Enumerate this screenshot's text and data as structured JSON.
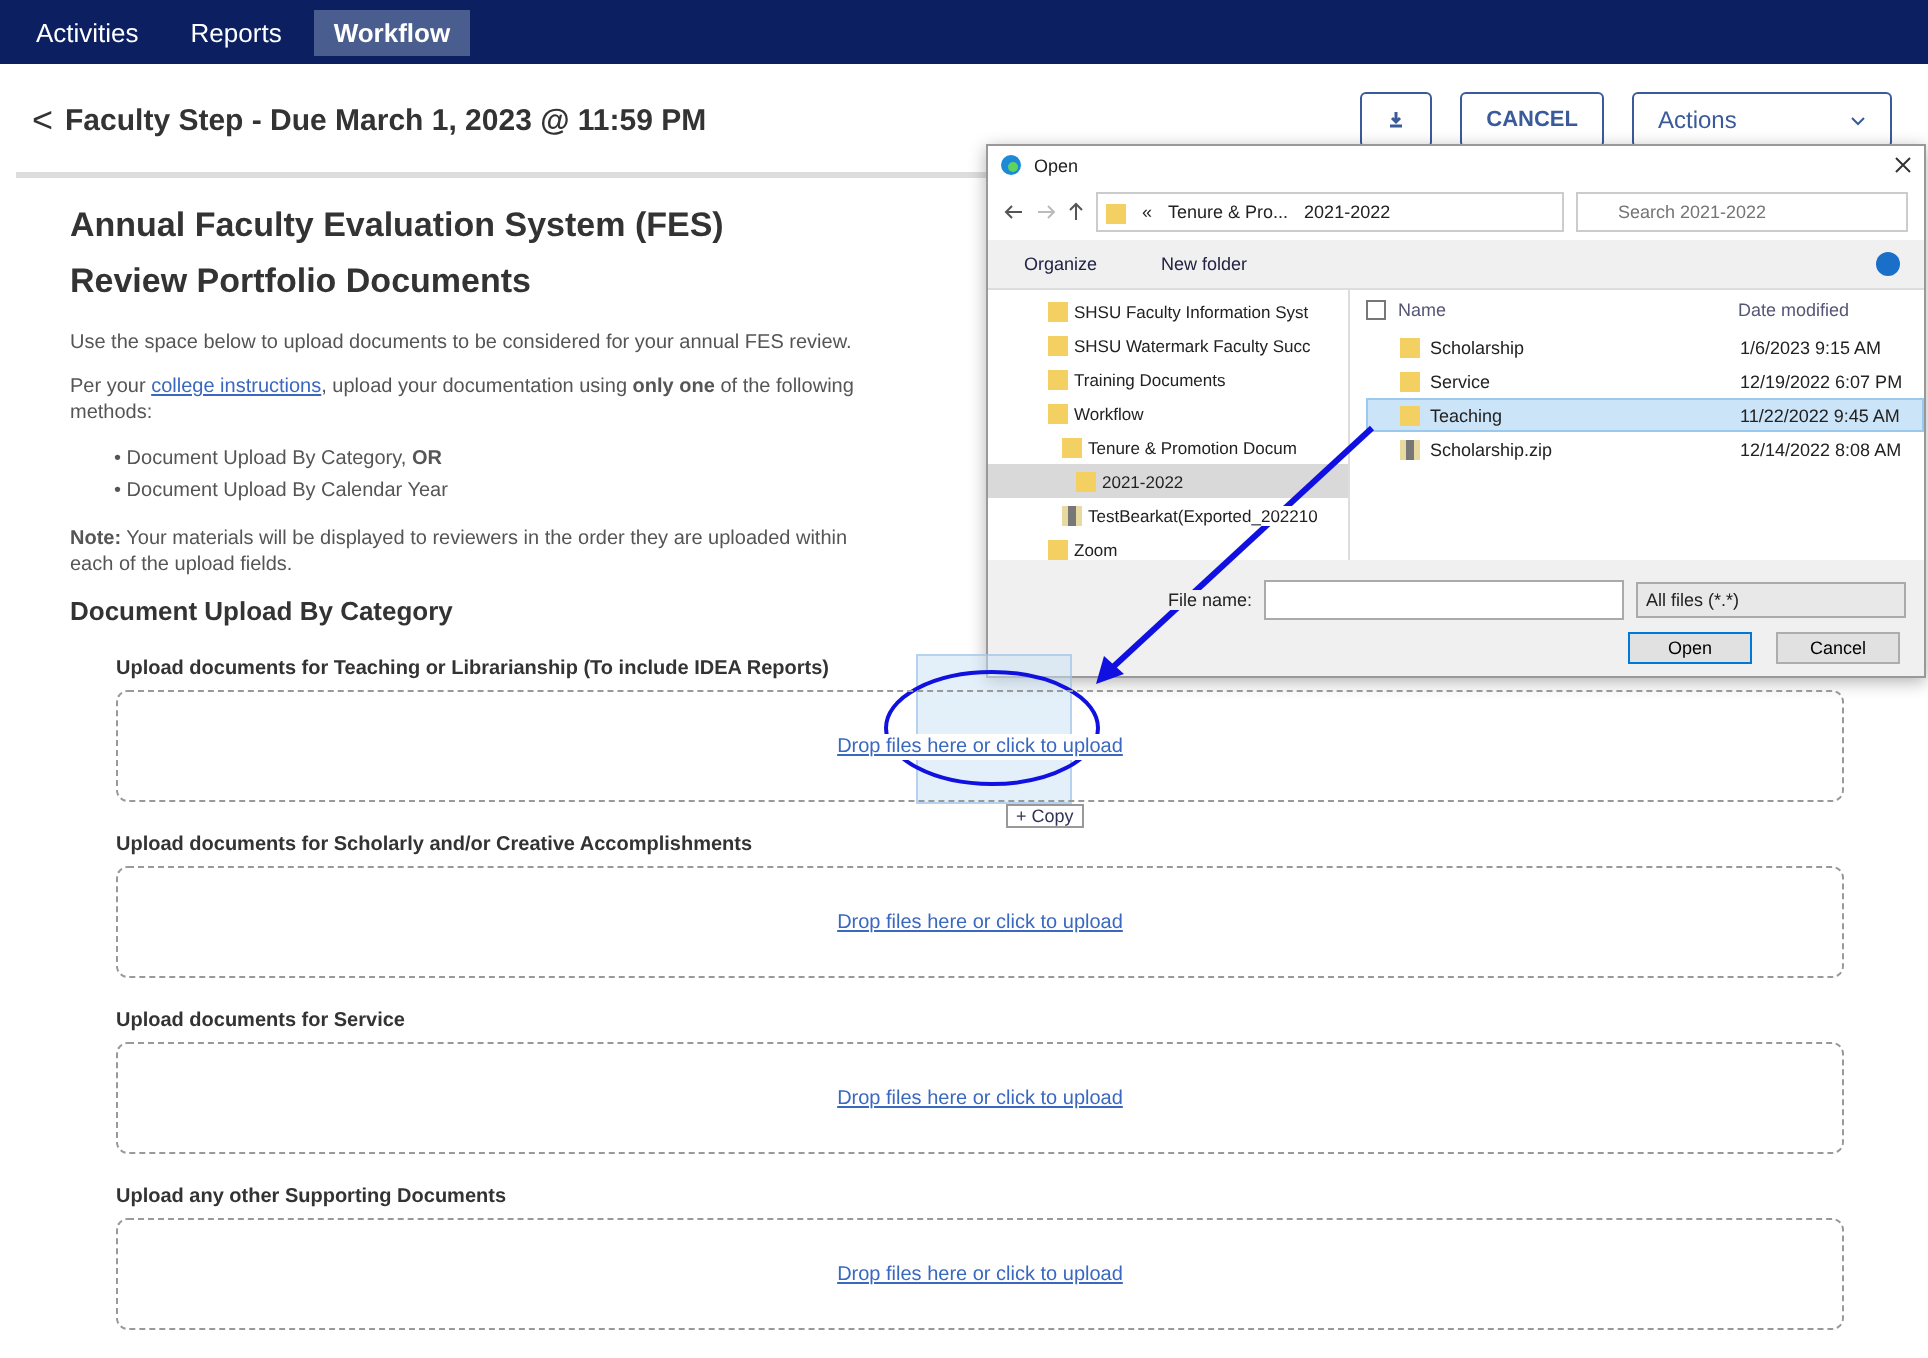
{
  "nav": [
    {
      "label": "Activities",
      "selected": false
    },
    {
      "label": "Reports",
      "selected": false
    },
    {
      "label": "Workflow",
      "selected": true
    }
  ],
  "header": {
    "back": "<",
    "title": "Faculty Step - Due March 1, 2023 @ 11:59 PM",
    "cancel": "CANCEL",
    "actions": "Actions"
  },
  "content": {
    "title": "Annual Faculty Evaluation System (FES)",
    "subtitle": "Review Portfolio Documents",
    "intro": "Use the space below to upload documents to be considered for your annual FES review.",
    "instructions": {
      "before": "Per your ",
      "link": "college instructions",
      "after": ", upload your documentation using **only one** of the following methods:"
    },
    "bullets": [
      "• Document Upload By Category, **OR**",
      "• Document Upload By Calendar Year"
    ],
    "note": "**Note:** Your materials will be displayed to reviewers in the order they are uploaded within each of the upload fields.",
    "section_title": "Document Upload By Category",
    "uploads": [
      {
        "label": "Upload documents for Teaching or Librarianship (To include IDEA Reports)",
        "prompt": "Drop files here or click to upload"
      },
      {
        "label": "Upload documents for Scholarly and/or Creative Accomplishments",
        "prompt": "Drop files here or click to upload"
      },
      {
        "label": "Upload documents for Service",
        "prompt": "Drop files here or click to upload"
      },
      {
        "label": "Upload any other Supporting Documents",
        "prompt": "Drop files here or click to upload"
      }
    ]
  },
  "dialog": {
    "title": "Open",
    "path": [
      "«",
      "Tenure & Pro...",
      "2021-2022"
    ],
    "search": {
      "placeholder": "Search 2021-2022"
    },
    "toolbar": [
      "Organize",
      "New folder"
    ],
    "tree": [
      {
        "label": "SHSU Faculty Information Syst",
        "kind": "folder",
        "selected": false
      },
      {
        "label": "SHSU Watermark Faculty Succ",
        "kind": "folder",
        "selected": false
      },
      {
        "label": "Training Documents",
        "kind": "folder",
        "selected": false
      },
      {
        "label": "Workflow",
        "kind": "folder",
        "selected": false,
        "children": [
          {
            "label": "Tenure & Promotion Docum",
            "kind": "folder",
            "selected": false,
            "children": [
              {
                "label": "2021-2022",
                "kind": "folder",
                "selected": true
              }
            ]
          },
          {
            "label": "TestBearkat(Exported_202210",
            "kind": "zip",
            "selected": false
          }
        ]
      },
      {
        "label": "Zoom",
        "kind": "folder",
        "selected": false
      }
    ],
    "select_all": {
      "checked": false
    },
    "columns": [
      "Name",
      "Date modified"
    ],
    "files": [
      {
        "name": "Scholarship",
        "date": "1/6/2023 9:15 AM",
        "kind": "folder",
        "selected": false
      },
      {
        "name": "Service",
        "date": "12/19/2022 6:07 PM",
        "kind": "folder",
        "selected": false
      },
      {
        "name": "Teaching",
        "date": "11/22/2022 9:45 AM",
        "kind": "folder",
        "selected": true
      },
      {
        "name": "Scholarship.zip",
        "date": "12/14/2022 8:08 AM",
        "kind": "zip",
        "selected": false
      }
    ],
    "filename_label": "File name:",
    "filter": "All files (*.*)",
    "open": "Open",
    "cancel": "Cancel"
  },
  "drag": {
    "badge": "+ Copy"
  }
}
